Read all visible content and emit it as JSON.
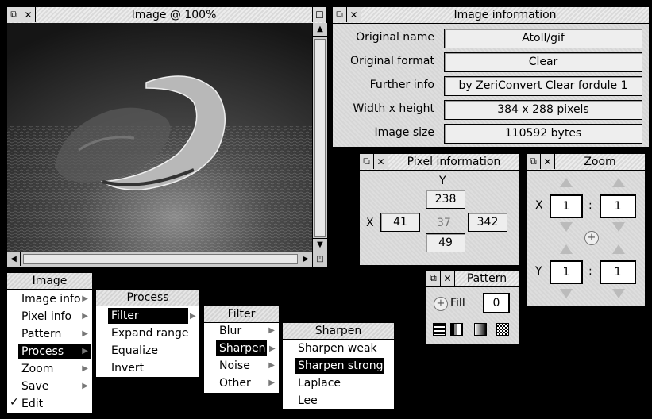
{
  "image_window": {
    "title": "Image @ 100%"
  },
  "info_window": {
    "title": "Image information",
    "rows": [
      {
        "label": "Original name",
        "value": "Atoll/gif"
      },
      {
        "label": "Original format",
        "value": "Clear"
      },
      {
        "label": "Further info",
        "value": "by ZeriConvert Clear fordule 1"
      },
      {
        "label": "Width x height",
        "value": "384 x 288 pixels"
      },
      {
        "label": "Image size",
        "value": "110592 bytes"
      }
    ]
  },
  "pixel_window": {
    "title": "Pixel information",
    "y_label": "Y",
    "x_label": "X",
    "top": "238",
    "left": "41",
    "center": "37",
    "right": "342",
    "bottom": "49"
  },
  "zoom_window": {
    "title": "Zoom",
    "x_label": "X",
    "y_label": "Y",
    "sep": ":",
    "x_num": "1",
    "x_den": "1",
    "y_num": "1",
    "y_den": "1"
  },
  "pattern_window": {
    "title": "Pattern",
    "fill_label": "Fill",
    "fill_value": "0"
  },
  "menus": {
    "image": {
      "title": "Image",
      "items": [
        "Image info",
        "Pixel info",
        "Pattern",
        "Process",
        "Zoom",
        "Save",
        "Edit"
      ],
      "check": "✓"
    },
    "process": {
      "title": "Process",
      "items": [
        "Filter",
        "Expand range",
        "Equalize",
        "Invert"
      ]
    },
    "filter": {
      "title": "Filter",
      "items": [
        "Blur",
        "Sharpen",
        "Noise",
        "Other"
      ]
    },
    "sharpen": {
      "title": "Sharpen",
      "items": [
        "Sharpen weak",
        "Sharpen strong",
        "Laplace",
        "Lee"
      ]
    }
  }
}
